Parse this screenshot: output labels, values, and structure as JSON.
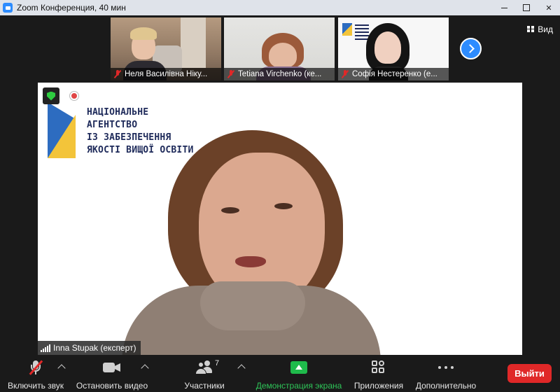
{
  "window": {
    "title": "Zoom Конференция, 40 мин"
  },
  "view_button": {
    "label": "Вид"
  },
  "thumbnails": [
    {
      "name": "Неля Василівна Ніку..."
    },
    {
      "name": "Tetiana Virchenko (ке..."
    },
    {
      "name": "Софія Нестеренко (е..."
    }
  ],
  "main_video": {
    "logo_lines": [
      "НАЦІОНАЛЬНЕ",
      "АГЕНТСТВО",
      "ІЗ ЗАБЕЗПЕЧЕННЯ",
      "ЯКОСТІ ВИЩОЇ ОСВІТИ"
    ],
    "speaker_name": "Inna Stupak (експерт)"
  },
  "toolbar": {
    "unmute_label": "Включить звук",
    "stop_video_label": "Остановить видео",
    "participants_label": "Участники",
    "participants_count": "7",
    "share_label": "Демонстрация экрана",
    "apps_label": "Приложения",
    "more_label": "Дополнительно",
    "leave_label": "Выйти"
  },
  "colors": {
    "accent_blue": "#2d8cff",
    "share_green": "#1fba4b",
    "leave_red": "#e02828",
    "toolbar_bg": "#1a1a1a"
  }
}
